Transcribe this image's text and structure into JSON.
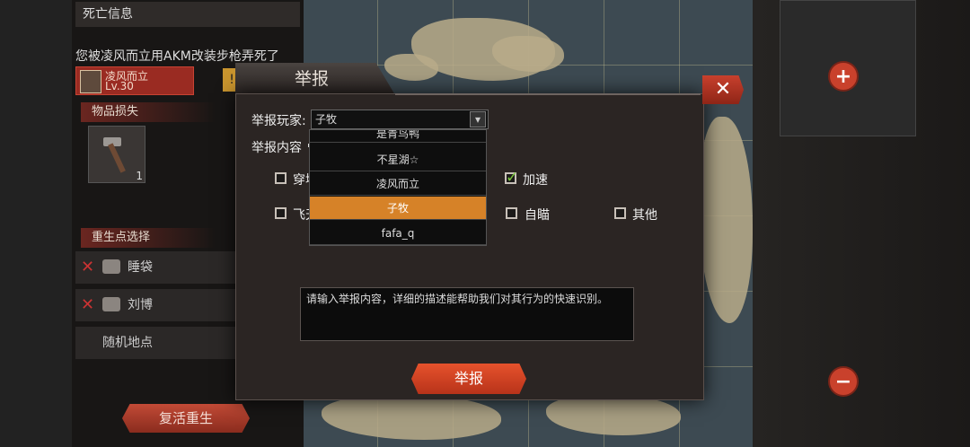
{
  "left_panel": {
    "header": "死亡信息",
    "death_message": "您被凌风而立用AKM改装步枪弄死了",
    "killer": {
      "name": "凌风而立",
      "level": "Lv.30"
    },
    "items_lost_label": "物品损失",
    "item_count": "1",
    "respawn_label": "重生点选择",
    "spawn_options": [
      {
        "label": "睡袋",
        "available": false
      },
      {
        "label": "刘博",
        "available": false
      },
      {
        "label": "随机地点",
        "available": true
      }
    ],
    "revive_button": "复活重生"
  },
  "dialog": {
    "title": "举报",
    "report_player_label": "举报玩家:",
    "selected_player": "子牧",
    "report_content_label": "举报内容",
    "dropdown_options": [
      "是青鸟鸭",
      "不星湖☆",
      "凌风而立",
      "子牧",
      "fafa_q"
    ],
    "dropdown_selected_index": 3,
    "reasons": [
      {
        "label": "穿墙",
        "checked": false
      },
      {
        "label": "加速",
        "checked": true
      },
      {
        "label": "飞天",
        "checked": false
      },
      {
        "label": "自瞄",
        "checked": false
      },
      {
        "label": "其他",
        "checked": false
      }
    ],
    "textarea_placeholder": "请输入举报内容，详细的描述能帮助我们对其行为的快速识别。",
    "submit_button": "举报",
    "close_symbol": "✕"
  },
  "hud": {
    "zoom_in": "+",
    "zoom_out": "−"
  },
  "colors": {
    "accent_red": "#c8402d",
    "selected_orange": "#d68228",
    "check_green": "#7ac63c"
  }
}
